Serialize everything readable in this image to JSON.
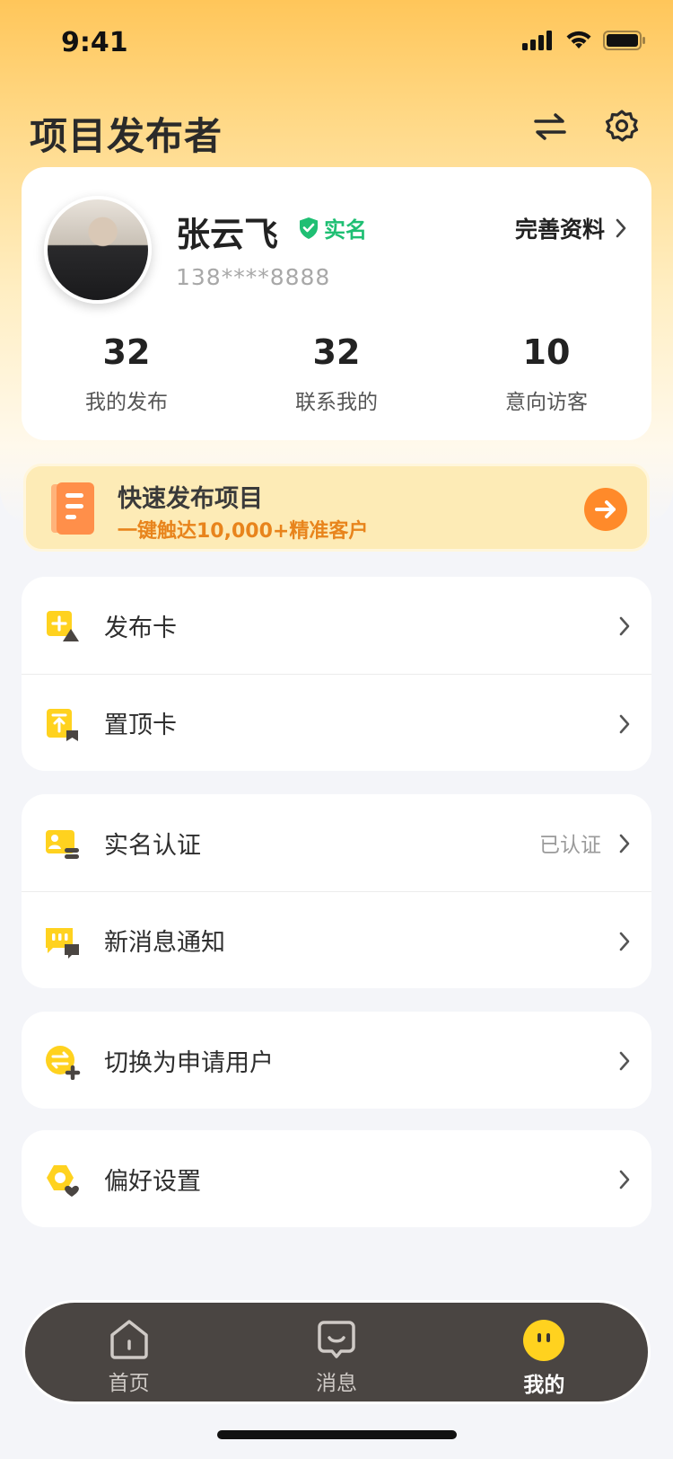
{
  "status": {
    "time": "9:41"
  },
  "header": {
    "title": "项目发布者",
    "switch_icon": "switch-arrows-icon",
    "settings_icon": "gear-icon"
  },
  "profile": {
    "name": "张云飞",
    "verify_label": "实名",
    "phone": "138****8888",
    "edit_label": "完善资料",
    "stats": [
      {
        "value": "32",
        "label": "我的发布"
      },
      {
        "value": "32",
        "label": "联系我的"
      },
      {
        "value": "10",
        "label": "意向访客"
      }
    ]
  },
  "promo": {
    "title": "快速发布项目",
    "subtitle": "一键触达10,000+精准客户"
  },
  "menu": {
    "cards": [
      {
        "label": "发布卡",
        "icon": "publish-card-icon"
      },
      {
        "label": "置顶卡",
        "icon": "pin-card-icon"
      }
    ],
    "account": [
      {
        "label": "实名认证",
        "value": "已认证",
        "icon": "id-card-icon"
      },
      {
        "label": "新消息通知",
        "icon": "message-notify-icon"
      }
    ],
    "switch": {
      "label": "切换为申请用户",
      "icon": "switch-user-icon"
    },
    "prefs": {
      "label": "偏好设置",
      "icon": "preference-icon"
    }
  },
  "tabbar": {
    "items": [
      {
        "label": "首页",
        "icon": "home-icon"
      },
      {
        "label": "消息",
        "icon": "chat-icon"
      },
      {
        "label": "我的",
        "icon": "smile-icon",
        "active": true
      }
    ]
  },
  "colors": {
    "accent": "#ffc65a",
    "verify": "#1fbf73",
    "promo_text": "#e8841c",
    "tabbar": "#4a4542"
  }
}
